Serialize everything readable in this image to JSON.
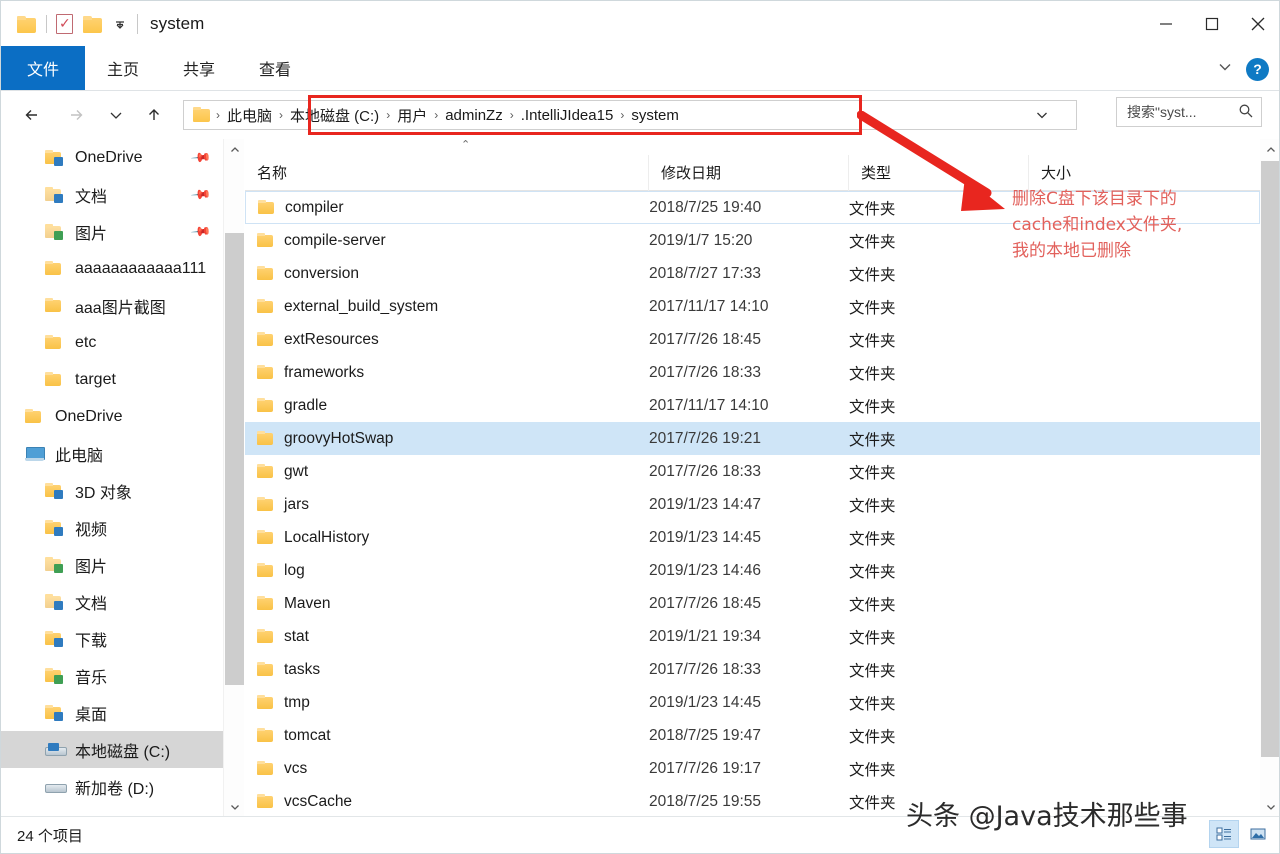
{
  "window": {
    "title": "system",
    "quick_access": [
      "folder-icon",
      "properties-icon",
      "new-folder-icon",
      "customize-dropdown-icon"
    ],
    "controls": {
      "minimize": "−",
      "maximize": "□",
      "close": "✕"
    }
  },
  "ribbon": {
    "tabs": [
      {
        "label": "文件",
        "active": true
      },
      {
        "label": "主页",
        "active": false
      },
      {
        "label": "共享",
        "active": false
      },
      {
        "label": "查看",
        "active": false
      }
    ],
    "collapse_label": "⌄",
    "help_label": "?"
  },
  "navigation": {
    "back": "←",
    "forward": "→",
    "recent": "⌄",
    "up": "↑",
    "refresh": "↻",
    "address_chevron": "⌄"
  },
  "breadcrumb": {
    "items": [
      "此电脑",
      "本地磁盘 (C:)",
      "用户",
      "adminZz",
      ".IntelliJIdea15",
      "system"
    ],
    "separator": "›",
    "highlight_color": "#e8261f"
  },
  "search": {
    "placeholder": "搜索\"syst...",
    "icon": "search-icon"
  },
  "sidebar": {
    "items": [
      {
        "label": "OneDrive",
        "level": 2,
        "icon": "folder-onedrive-icon",
        "pinned": true,
        "selected": false
      },
      {
        "label": "文档",
        "level": 2,
        "icon": "folder-documents-icon",
        "pinned": true,
        "selected": false
      },
      {
        "label": "图片",
        "level": 2,
        "icon": "folder-pictures-icon",
        "pinned": true,
        "selected": false
      },
      {
        "label": "aaaaaaaaaaaa111",
        "level": 2,
        "icon": "folder-icon",
        "pinned": false,
        "selected": false
      },
      {
        "label": "aaa图片截图",
        "level": 2,
        "icon": "folder-icon",
        "pinned": false,
        "selected": false
      },
      {
        "label": "etc",
        "level": 2,
        "icon": "folder-icon",
        "pinned": false,
        "selected": false
      },
      {
        "label": "target",
        "level": 2,
        "icon": "folder-icon",
        "pinned": false,
        "selected": false
      },
      {
        "label": "OneDrive",
        "level": 1,
        "icon": "folder-icon",
        "pinned": false,
        "selected": false
      },
      {
        "label": "此电脑",
        "level": 1,
        "icon": "this-pc-icon",
        "pinned": false,
        "selected": false
      },
      {
        "label": "3D 对象",
        "level": 2,
        "icon": "folder-3d-icon",
        "pinned": false,
        "selected": false
      },
      {
        "label": "视频",
        "level": 2,
        "icon": "folder-videos-icon",
        "pinned": false,
        "selected": false
      },
      {
        "label": "图片",
        "level": 2,
        "icon": "folder-pictures-icon",
        "pinned": false,
        "selected": false
      },
      {
        "label": "文档",
        "level": 2,
        "icon": "folder-documents-icon",
        "pinned": false,
        "selected": false
      },
      {
        "label": "下载",
        "level": 2,
        "icon": "folder-downloads-icon",
        "pinned": false,
        "selected": false
      },
      {
        "label": "音乐",
        "level": 2,
        "icon": "folder-music-icon",
        "pinned": false,
        "selected": false
      },
      {
        "label": "桌面",
        "level": 2,
        "icon": "folder-desktop-icon",
        "pinned": false,
        "selected": false
      },
      {
        "label": "本地磁盘 (C:)",
        "level": 2,
        "icon": "system-drive-icon",
        "pinned": false,
        "selected": true
      },
      {
        "label": "新加卷 (D:)",
        "level": 2,
        "icon": "drive-icon",
        "pinned": false,
        "selected": false
      }
    ]
  },
  "filelist": {
    "sort_indicator": "⌃",
    "columns": [
      {
        "key": "name",
        "label": "名称"
      },
      {
        "key": "date",
        "label": "修改日期"
      },
      {
        "key": "type",
        "label": "类型"
      },
      {
        "key": "size",
        "label": "大小"
      }
    ],
    "rows": [
      {
        "name": "compiler",
        "date": "2018/7/25 19:40",
        "type": "文件夹",
        "size": "",
        "state": "focused"
      },
      {
        "name": "compile-server",
        "date": "2019/1/7 15:20",
        "type": "文件夹",
        "size": "",
        "state": "normal"
      },
      {
        "name": "conversion",
        "date": "2018/7/27 17:33",
        "type": "文件夹",
        "size": "",
        "state": "normal"
      },
      {
        "name": "external_build_system",
        "date": "2017/11/17 14:10",
        "type": "文件夹",
        "size": "",
        "state": "normal"
      },
      {
        "name": "extResources",
        "date": "2017/7/26 18:45",
        "type": "文件夹",
        "size": "",
        "state": "normal"
      },
      {
        "name": "frameworks",
        "date": "2017/7/26 18:33",
        "type": "文件夹",
        "size": "",
        "state": "normal"
      },
      {
        "name": "gradle",
        "date": "2017/11/17 14:10",
        "type": "文件夹",
        "size": "",
        "state": "normal"
      },
      {
        "name": "groovyHotSwap",
        "date": "2017/7/26 19:21",
        "type": "文件夹",
        "size": "",
        "state": "selected"
      },
      {
        "name": "gwt",
        "date": "2017/7/26 18:33",
        "type": "文件夹",
        "size": "",
        "state": "normal"
      },
      {
        "name": "jars",
        "date": "2019/1/23 14:47",
        "type": "文件夹",
        "size": "",
        "state": "normal"
      },
      {
        "name": "LocalHistory",
        "date": "2019/1/23 14:45",
        "type": "文件夹",
        "size": "",
        "state": "normal"
      },
      {
        "name": "log",
        "date": "2019/1/23 14:46",
        "type": "文件夹",
        "size": "",
        "state": "normal"
      },
      {
        "name": "Maven",
        "date": "2017/7/26 18:45",
        "type": "文件夹",
        "size": "",
        "state": "normal"
      },
      {
        "name": "stat",
        "date": "2019/1/21 19:34",
        "type": "文件夹",
        "size": "",
        "state": "normal"
      },
      {
        "name": "tasks",
        "date": "2017/7/26 18:33",
        "type": "文件夹",
        "size": "",
        "state": "normal"
      },
      {
        "name": "tmp",
        "date": "2019/1/23 14:45",
        "type": "文件夹",
        "size": "",
        "state": "normal"
      },
      {
        "name": "tomcat",
        "date": "2018/7/25 19:47",
        "type": "文件夹",
        "size": "",
        "state": "normal"
      },
      {
        "name": "vcs",
        "date": "2017/7/26 19:17",
        "type": "文件夹",
        "size": "",
        "state": "normal"
      },
      {
        "name": "vcsCache",
        "date": "2018/7/25 19:55",
        "type": "文件夹",
        "size": "",
        "state": "normal"
      }
    ]
  },
  "annotation": {
    "text": "删除C盘下该目录下的\ncache和index文件夹,\n我的本地已删除",
    "color": "#e2615c",
    "arrow": "red-arrow-icon"
  },
  "statusbar": {
    "item_count": "24 个项目",
    "views": [
      {
        "name": "details-view",
        "active": true
      },
      {
        "name": "large-icons-view",
        "active": false
      }
    ]
  },
  "watermark": {
    "text": "头条 @Java技术那些事"
  }
}
